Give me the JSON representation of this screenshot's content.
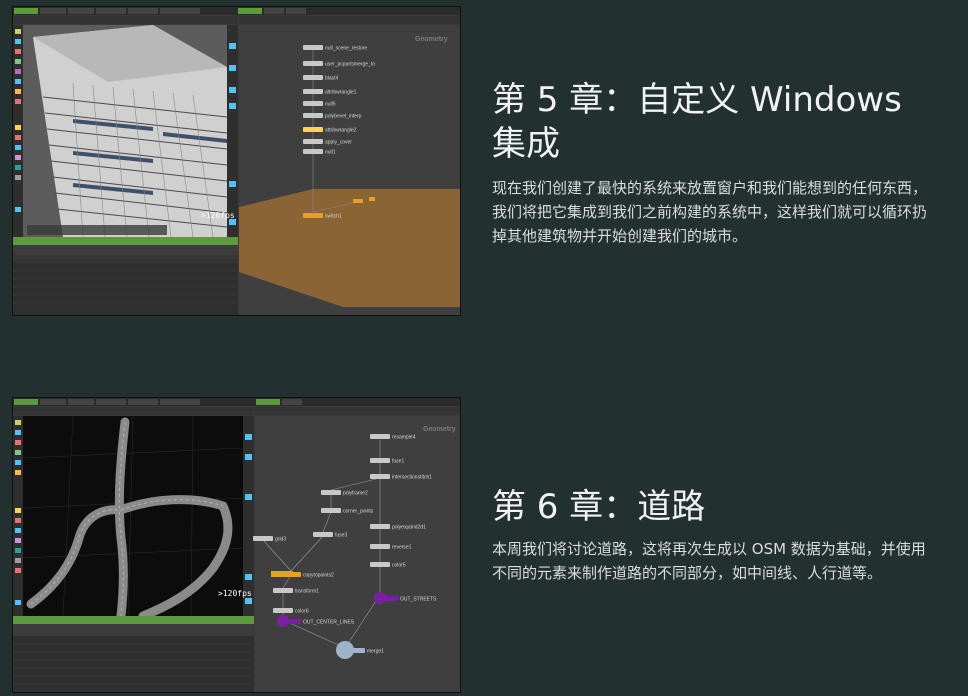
{
  "chapters": [
    {
      "title": "第 5 章：自定义 Windows 集成",
      "description": "现在我们创建了最快的系统来放置窗户和我们能想到的任何东西，我们将把它集成到我们之前构建的系统中，这样我们就可以循环扔掉其他建筑物并开始创建我们的城市。",
      "screenshot": {
        "fps": ">120fps",
        "network_label": "Geometry",
        "nodes": [
          "null_scene_restore",
          "user_pcpartsmerge_to",
          "blast4",
          "attribwrangle1",
          "null5",
          "polybevel_interp",
          "attribwrangle2",
          "apply_cover",
          "null1",
          "switch1"
        ]
      }
    },
    {
      "title": "第 6 章：道路",
      "description": "本周我们将讨论道路，这将再次生成以 OSM 数据为基础，并使用不同的元素来制作道路的不同部分，如中间线、人行道等。",
      "screenshot": {
        "fps": ">120fps",
        "network_label": "Geometry",
        "nodes": [
          "resample4",
          "fuse1",
          "intersectionstitch1",
          "polyframe2",
          "corner_points",
          "fuse3",
          "polyexpand2d1",
          "grid3",
          "reverse1",
          "color5",
          "copytopoints2",
          "transform1",
          "color6",
          "OUT_STREETS",
          "OUT_CENTER_LINES",
          "merge1"
        ]
      }
    }
  ],
  "colors": {
    "page_bg": "#233030",
    "houdini_bg": "#3a3a3a",
    "accent_green": "#5b9a3e",
    "orange_node": "#e8a020",
    "purple_node": "#7b1fa2"
  }
}
